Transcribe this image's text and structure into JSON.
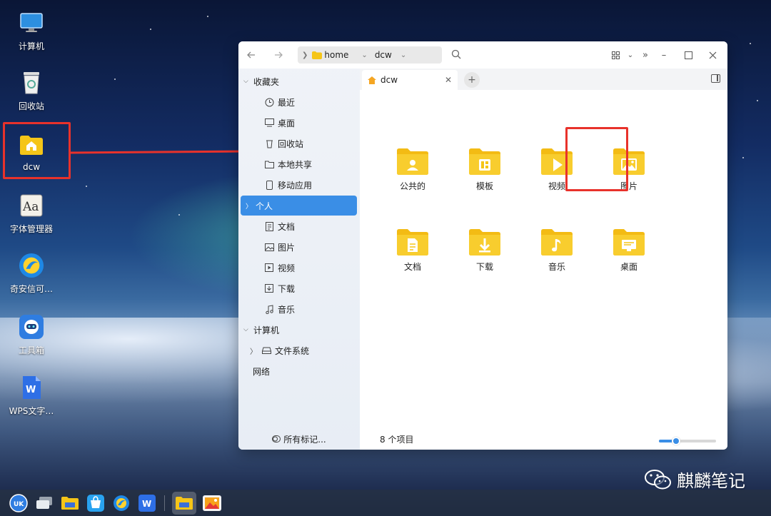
{
  "desktop": {
    "icons": [
      {
        "label": "计算机",
        "icon": "computer-icon"
      },
      {
        "label": "回收站",
        "icon": "trash-icon"
      },
      {
        "label": "dcw",
        "icon": "home-folder-icon"
      },
      {
        "label": "字体管理器",
        "icon": "font-manager-icon"
      },
      {
        "label": "奇安信可…",
        "icon": "browser-icon"
      },
      {
        "label": "工具箱",
        "icon": "toolbox-icon"
      },
      {
        "label": "WPS文字…",
        "icon": "wps-writer-icon"
      }
    ]
  },
  "window": {
    "path": [
      "home",
      "dcw"
    ],
    "tab_label": "dcw",
    "sidebar": {
      "favorites_label": "收藏夹",
      "favorites": [
        "最近",
        "桌面",
        "回收站",
        "本地共享",
        "移动应用"
      ],
      "personal_label": "个人",
      "personal": [
        "文档",
        "图片",
        "视频",
        "下载",
        "音乐"
      ],
      "computer_label": "计算机",
      "computer": [
        "文件系统"
      ],
      "network_label": "网络",
      "footer_label": "所有标记..."
    },
    "items": [
      {
        "label": "公共的",
        "icon": "public-folder-icon"
      },
      {
        "label": "模板",
        "icon": "template-folder-icon"
      },
      {
        "label": "视频",
        "icon": "video-folder-icon"
      },
      {
        "label": "图片",
        "icon": "picture-folder-icon"
      },
      {
        "label": "文档",
        "icon": "document-folder-icon"
      },
      {
        "label": "下载",
        "icon": "download-folder-icon"
      },
      {
        "label": "音乐",
        "icon": "music-folder-icon"
      },
      {
        "label": "桌面",
        "icon": "desktop-folder-icon"
      }
    ],
    "status": "8 个项目",
    "zoom_level": 0.3
  },
  "watermark": "麒麟笔记",
  "colors": {
    "accent": "#3a8ee6",
    "highlight": "#e8322b",
    "folder": "#f5c518"
  }
}
